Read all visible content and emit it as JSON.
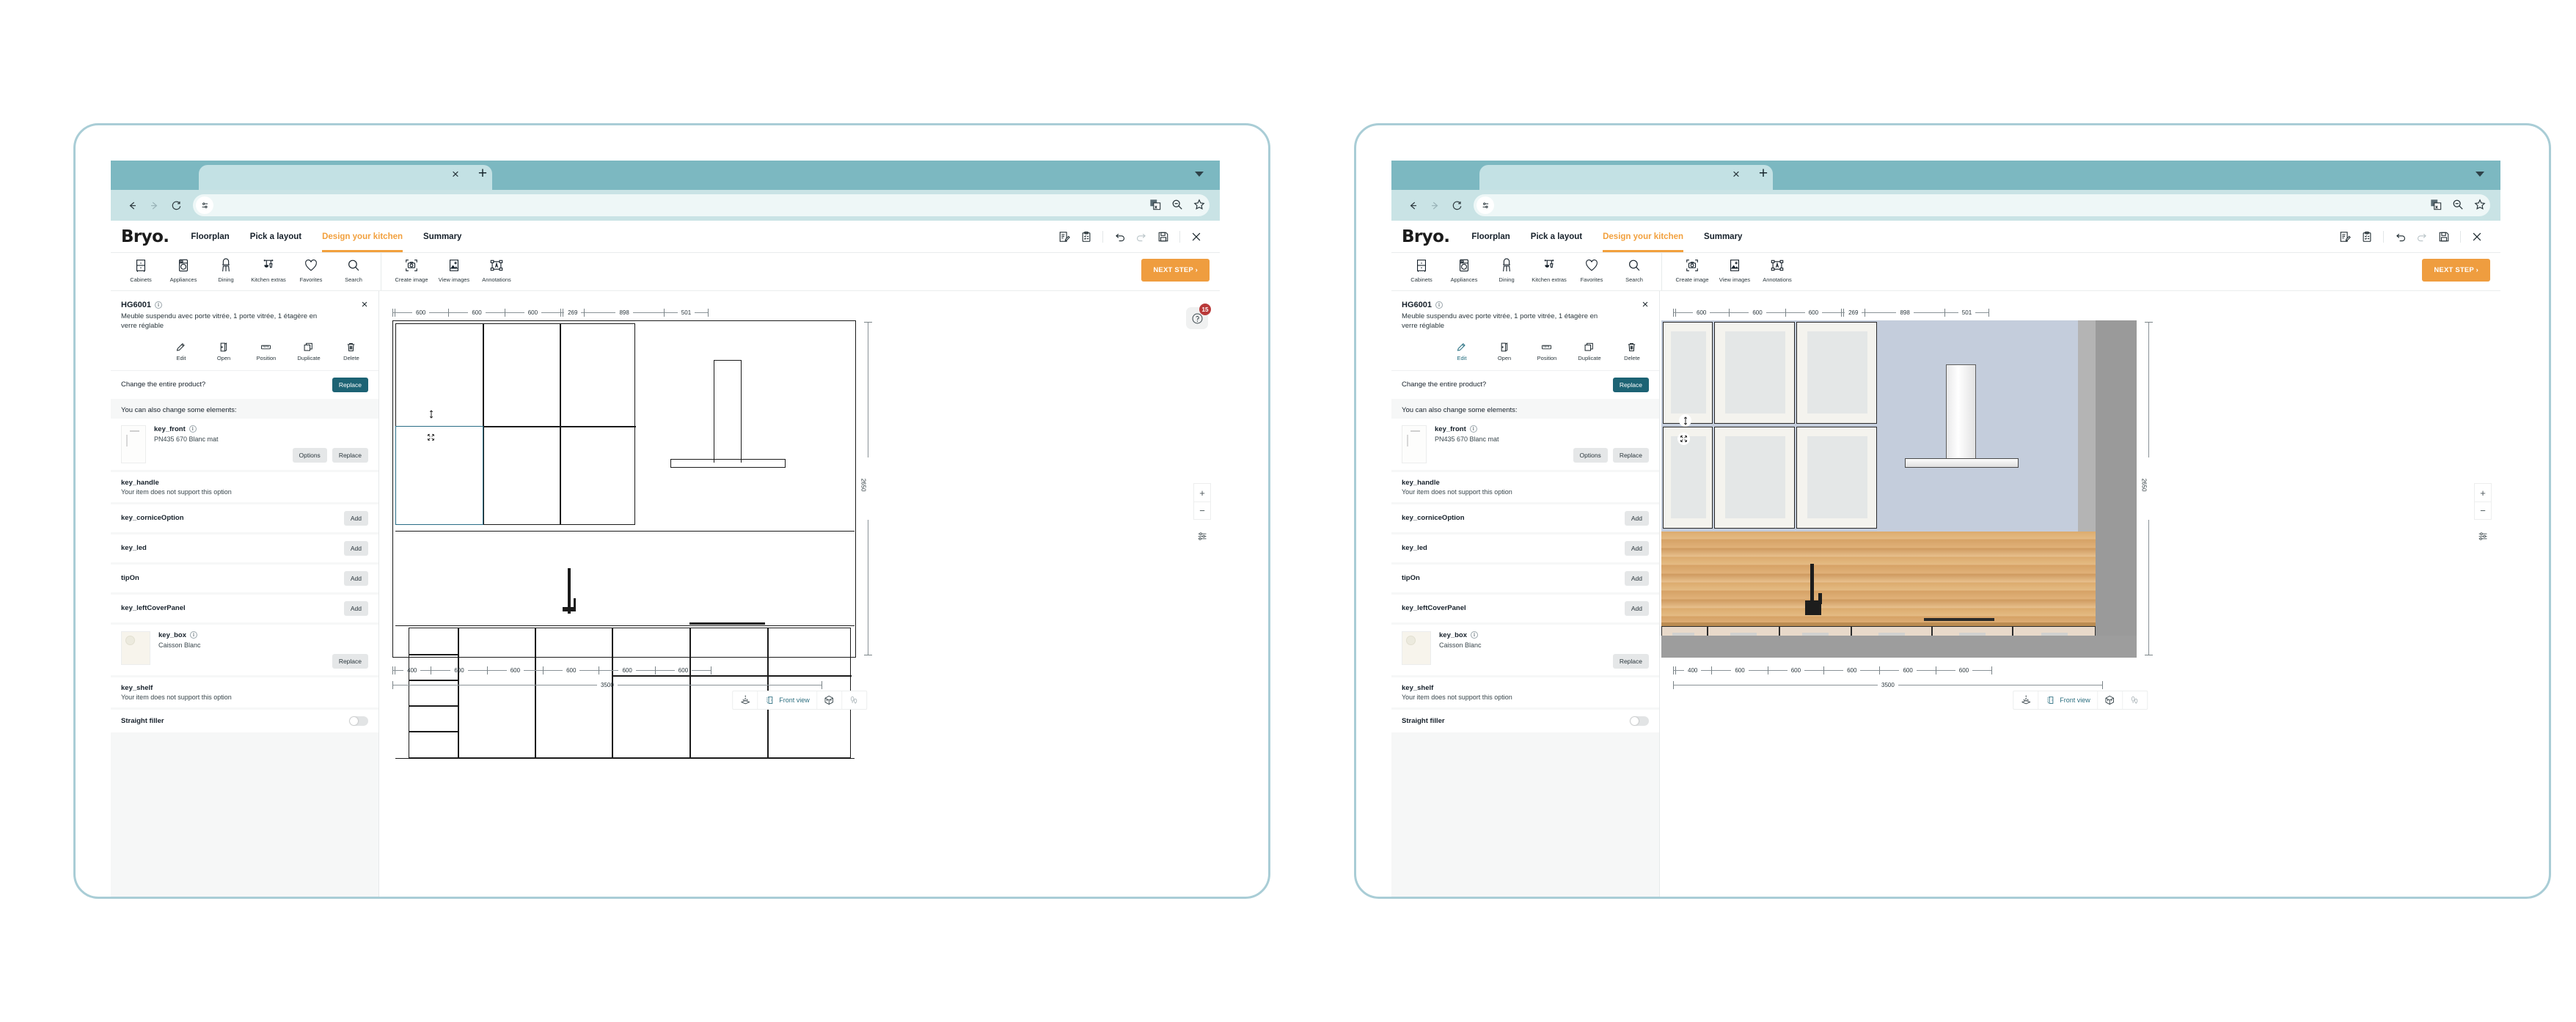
{
  "browser": {
    "tab_close": "×",
    "tab_new": "+",
    "back_icon": "back-arrow-icon",
    "forward_icon": "forward-arrow-icon",
    "reload_icon": "reload-icon",
    "url_value": "",
    "url_placeholder": "",
    "right_icons": [
      "translate-icon",
      "zoom-out-icon",
      "bookmark-star-icon"
    ]
  },
  "header": {
    "logo": "Bryo.",
    "tabs": [
      {
        "label": "Floorplan",
        "active": false
      },
      {
        "label": "Pick a layout",
        "active": false
      },
      {
        "label": "Design your kitchen",
        "active": true
      },
      {
        "label": "Summary",
        "active": false
      }
    ],
    "icons": [
      "edit-note-icon",
      "clipboard-list-icon",
      "undo-icon",
      "redo-icon",
      "save-icon",
      "close-icon"
    ],
    "accent_color": "#f2a03d"
  },
  "ribbon": {
    "group_one": [
      {
        "label": "Cabinets",
        "icon": "cabinet-icon"
      },
      {
        "label": "Appliances",
        "icon": "washing-machine-icon"
      },
      {
        "label": "Dining",
        "icon": "chair-icon"
      },
      {
        "label": "Kitchen extras",
        "icon": "utensils-rail-icon"
      },
      {
        "label": "Favorites",
        "icon": "heart-icon"
      },
      {
        "label": "Search",
        "icon": "search-icon"
      }
    ],
    "group_two": [
      {
        "label": "Create image",
        "icon": "camera-frame-icon"
      },
      {
        "label": "View images",
        "icon": "picture-icon"
      },
      {
        "label": "Annotations",
        "icon": "annotation-frame-icon"
      }
    ],
    "next_step": "NEXT STEP ›",
    "next_step_color": "#ef9d3f"
  },
  "sidebar": {
    "product_code": "HG6001",
    "product_desc": "Meuble suspendu avec porte vitrée, 1 porte vitrée, 1 étagère en verre réglable",
    "close": "×",
    "actions": [
      {
        "label": "Edit",
        "icon": "pencil-icon"
      },
      {
        "label": "Open",
        "icon": "open-door-icon"
      },
      {
        "label": "Position",
        "icon": "ruler-icon"
      },
      {
        "label": "Duplicate",
        "icon": "duplicate-icon"
      },
      {
        "label": "Delete",
        "icon": "trash-icon"
      }
    ],
    "change_product_label": "Change the entire product?",
    "replace_label": "Replace",
    "elements_label": "You can also change some elements:",
    "elements": [
      {
        "name": "key_front",
        "sub": "PN435 670 Blanc mat",
        "has_info": true,
        "thumb": "front-thumb",
        "buttons": [
          "Options",
          "Replace"
        ]
      },
      {
        "name": "key_handle",
        "note": "Your item does not support this option"
      },
      {
        "name": "key_corniceOption",
        "button": "Add"
      },
      {
        "name": "key_led",
        "button": "Add"
      },
      {
        "name": "tipOn",
        "button": "Add"
      },
      {
        "name": "key_leftCoverPanel",
        "button": "Add"
      },
      {
        "name": "key_box",
        "sub": "Caisson Blanc",
        "has_info": true,
        "thumb": "box-thumb",
        "buttons": [
          "Replace"
        ]
      },
      {
        "name": "key_shelf",
        "note": "Your item does not support this option"
      },
      {
        "name": "Straight filler",
        "toggle": true
      }
    ]
  },
  "canvas": {
    "help_icon": "help-circle-icon",
    "help_badge": "15",
    "ruler_top": {
      "segments": [
        "600",
        "600",
        "600",
        "269",
        "898",
        "501"
      ]
    },
    "ruler_bottom": {
      "segments": [
        "400",
        "600",
        "600",
        "600",
        "600",
        "600"
      ],
      "total": "3500"
    },
    "vertical_dimension": "2650",
    "zoom_in": "+",
    "zoom_out": "−",
    "layers_icon": "sliders-icon",
    "viewbar": [
      {
        "label": "",
        "icon": "plan-3d-icon",
        "active": false
      },
      {
        "label": "Front view",
        "icon": "front-view-icon",
        "active": true
      },
      {
        "label": "",
        "icon": "cube-icon",
        "active": false
      },
      {
        "label": "",
        "icon": "walk-icon",
        "active": false
      }
    ],
    "selection_badges": [
      "resize-vertical-icon",
      "move-icon"
    ]
  },
  "panels": [
    {
      "id": "left",
      "mode": "wireframe"
    },
    {
      "id": "right",
      "mode": "rendered"
    }
  ]
}
